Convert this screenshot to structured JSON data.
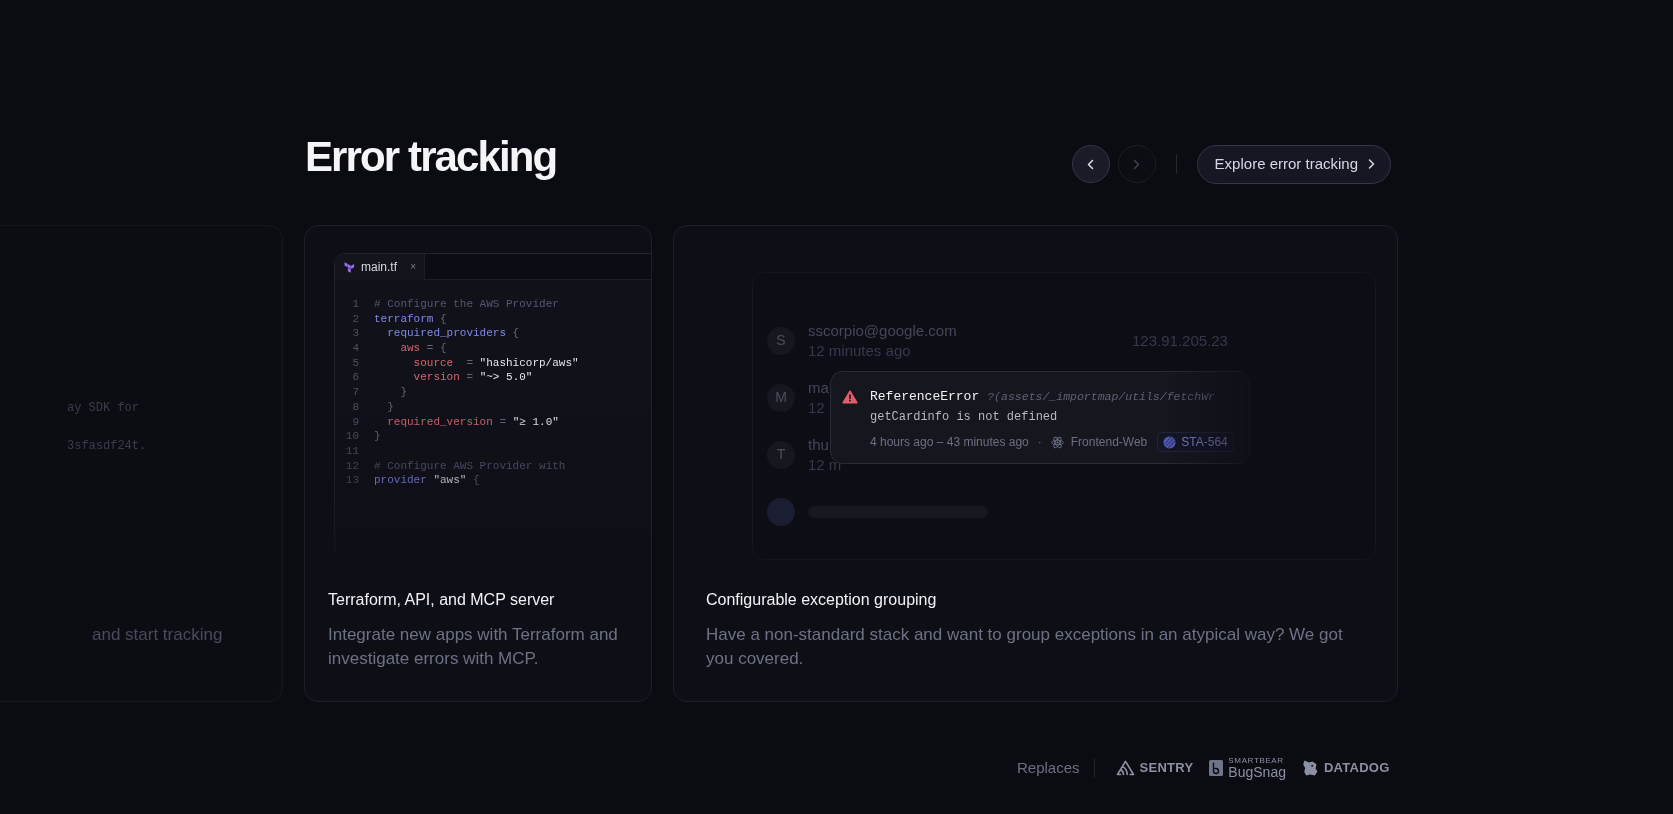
{
  "heading": "Error tracking",
  "carousel_controls": [
    {
      "kind": "prev",
      "disabled": false
    },
    {
      "kind": "next",
      "disabled": true
    }
  ],
  "explore_button": {
    "label": "Explore error tracking"
  },
  "cards": [
    {
      "kind": "partial",
      "code_lines": [
        "ay SDK for",
        "3sfasdf24t."
      ],
      "description": "and start tracking"
    },
    {
      "kind": "code",
      "editor": {
        "tab": {
          "label": "main.tf",
          "close": "×"
        },
        "lines": [
          {
            "number": "1",
            "tokens": [
              {
                "kind": "comment",
                "text": "# Configure the AWS Provider"
              }
            ]
          },
          {
            "number": "2",
            "tokens": [
              {
                "kind": "keyword",
                "text": "terraform"
              },
              {
                "kind": "punct",
                "text": " {"
              }
            ],
            "children": [
              {
                "number": "3",
                "tokens": [
                  {
                    "kind": "keyword",
                    "text": "required_providers"
                  },
                  {
                    "kind": "punct",
                    "text": " {"
                  }
                ],
                "children": [
                  {
                    "number": "4",
                    "tokens": [
                      {
                        "kind": "attr",
                        "text": "aws"
                      },
                      {
                        "kind": "punct",
                        "text": " = {"
                      }
                    ],
                    "children": [
                      {
                        "number": "5",
                        "tokens": [
                          {
                            "kind": "attr",
                            "text": "source"
                          },
                          {
                            "kind": "punct",
                            "text": "  = "
                          },
                          {
                            "kind": "string",
                            "text": "\"hashicorp/aws\""
                          }
                        ]
                      },
                      {
                        "number": "6",
                        "tokens": [
                          {
                            "kind": "attr",
                            "text": "version"
                          },
                          {
                            "kind": "punct",
                            "text": " = "
                          },
                          {
                            "kind": "string",
                            "text": "\"~> 5.0\""
                          }
                        ]
                      }
                    ]
                  },
                  {
                    "number": "7",
                    "tokens": [
                      {
                        "kind": "punct",
                        "text": "}"
                      }
                    ]
                  }
                ]
              },
              {
                "number": "8",
                "tokens": [
                  {
                    "kind": "punct",
                    "text": "}"
                  }
                ]
              },
              {
                "number": "9",
                "tokens": [
                  {
                    "kind": "attr",
                    "text": "required_version"
                  },
                  {
                    "kind": "punct",
                    "text": " = "
                  },
                  {
                    "kind": "string",
                    "text": "\"≥ 1.0\""
                  }
                ]
              }
            ]
          },
          {
            "number": "10",
            "tokens": [
              {
                "kind": "punct",
                "text": "}"
              }
            ]
          },
          {
            "number": "11"
          },
          {
            "number": "12",
            "tokens": [
              {
                "kind": "comment",
                "text": "# Configure AWS Provider with"
              }
            ]
          },
          {
            "number": "13",
            "tokens": [
              {
                "kind": "keyword",
                "text": "provider"
              },
              {
                "kind": "string",
                "text": " \"aws\""
              },
              {
                "kind": "punct",
                "text": " {"
              }
            ]
          }
        ]
      },
      "title": "Terraform, API, and MCP server",
      "description": "Integrate new apps with Terraform and investigate errors with MCP."
    },
    {
      "kind": "sessions",
      "sessions": [
        {
          "kind": "row",
          "avatar": "S",
          "name": "sscorpio@google.com",
          "time": "12 minutes ago",
          "ip": "123.91.205.23"
        },
        {
          "kind": "row",
          "avatar": "M",
          "name": "ma",
          "time": "12"
        },
        {
          "kind": "row",
          "avatar": "T",
          "name": "thu",
          "time": "12 m"
        },
        {
          "kind": "blurred"
        }
      ],
      "error_popup": {
        "name": "ReferenceError",
        "path": "?(assets/_importmap/utils/fetchWr",
        "message": "getCardinfo is not defined",
        "time": "4 hours ago – 43 minutes ago",
        "separator": "·",
        "project": "Frontend-Web",
        "issue": "STA-564"
      },
      "title": "Configurable exception grouping",
      "description": "Have a non-standard stack and want to group exceptions in an atypical way? We got you covered."
    }
  ],
  "replaces": {
    "label": "Replaces",
    "logos": [
      {
        "kind": "sentry",
        "text": "SENTRY"
      },
      {
        "kind": "bugsnag",
        "overline": "SMARTBEAR",
        "text": "BugSnag"
      },
      {
        "kind": "datadog",
        "text": "DATADOG"
      }
    ]
  }
}
